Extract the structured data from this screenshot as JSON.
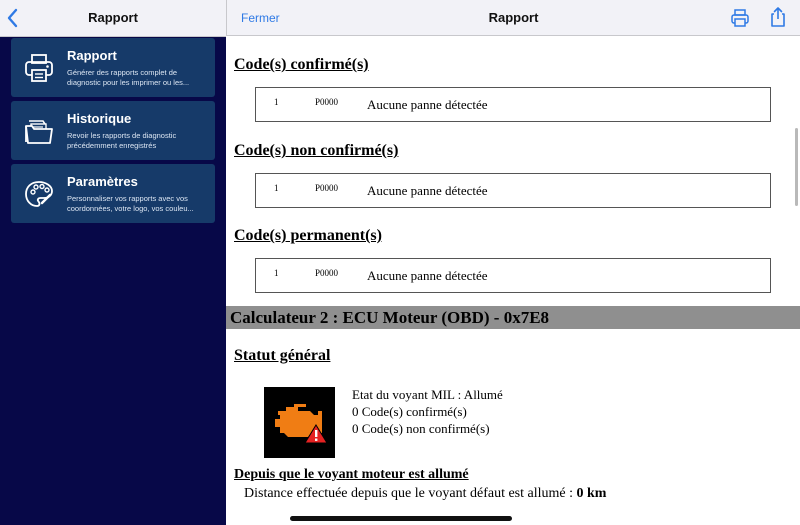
{
  "sidebar": {
    "title": "Rapport",
    "items": [
      {
        "title": "Rapport",
        "description": "Générer des rapports complet de diagnostic pour les imprimer ou les...",
        "icon": "printer-icon"
      },
      {
        "title": "Historique",
        "description": "Revoir les rapports de diagnostic précédemment enregistrés",
        "icon": "folder-documents-icon"
      },
      {
        "title": "Paramètres",
        "description": "Personnaliser vos rapports avec vos coordonnées, votre logo, vos couleu...",
        "icon": "palette-icon"
      }
    ]
  },
  "header": {
    "close_label": "Fermer",
    "title": "Rapport"
  },
  "report": {
    "confirmed": {
      "title": "Code(s) confirmé(s)",
      "row": {
        "num": "1",
        "code": "P0000",
        "desc": "Aucune panne détectée"
      }
    },
    "unconfirmed": {
      "title": "Code(s) non confirmé(s)",
      "row": {
        "num": "1",
        "code": "P0000",
        "desc": "Aucune panne détectée"
      }
    },
    "permanent": {
      "title": "Code(s) permanent(s)",
      "row": {
        "num": "1",
        "code": "P0000",
        "desc": "Aucune panne détectée"
      }
    },
    "ecu_title": "Calculateur 2 : ECU Moteur (OBD) - 0x7E8",
    "status_title": "Statut général",
    "status_lines": [
      "Etat du voyant MIL : Allumé",
      "0 Code(s) confirmé(s)",
      "0 Code(s) non confirmé(s)"
    ],
    "since_title": "Depuis que le voyant moteur est allumé",
    "distance_label": "Distance effectuée depuis que le voyant défaut est allumé :",
    "distance_value": "0 km"
  },
  "colors": {
    "sidebar_bg": "#070848",
    "card_bg": "#163a69",
    "accent": "#2f7ae5",
    "engine_orange": "#f07d14",
    "warning_red": "#e52222"
  }
}
